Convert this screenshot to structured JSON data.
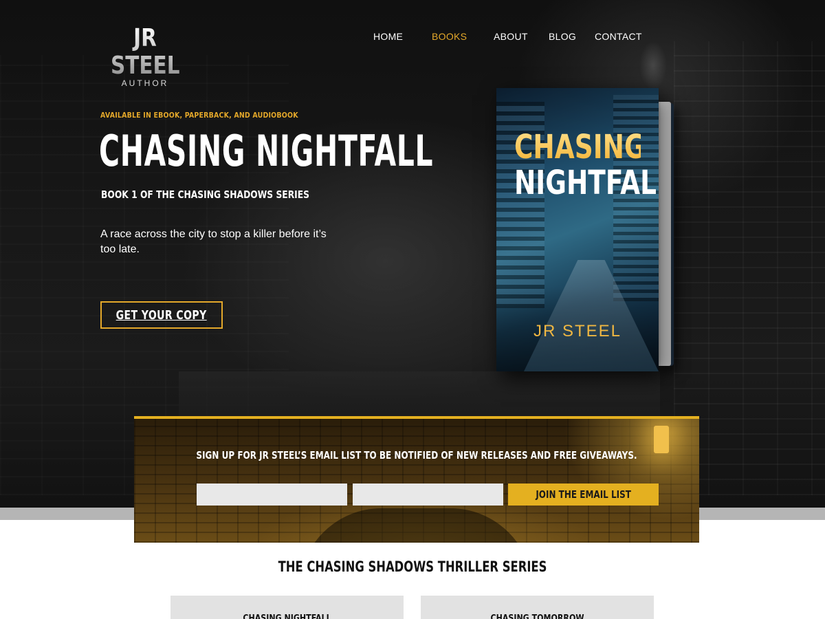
{
  "brand": {
    "name": "JR STEEL",
    "subtitle": "AUTHOR"
  },
  "nav": {
    "items": [
      {
        "label": "HOME",
        "active": false
      },
      {
        "label": "BOOKS",
        "active": true
      },
      {
        "label": "ABOUT",
        "active": false
      },
      {
        "label": "BLOG",
        "active": false
      },
      {
        "label": "CONTACT",
        "active": false
      }
    ]
  },
  "hero": {
    "eyebrow": "AVAILABLE IN EBOOK, PAPERBACK, AND AUDIOBOOK",
    "title": "CHASING NIGHTFALL",
    "series_label": "BOOK 1 OF THE CHASING SHADOWS SERIES",
    "tagline": "A race across the city to stop a killer before it’s too late.",
    "cta_label": "GET YOUR COPY"
  },
  "book_cover": {
    "title_line1": "CHASING",
    "title_line2": "NIGHTFALL",
    "author": "JR STEEL"
  },
  "signup": {
    "text": "SIGN UP FOR JR STEEL’S EMAIL LIST TO BE NOTIFIED OF NEW RELEASES AND FREE GIVEAWAYS.",
    "first_field_value": "",
    "second_field_value": "",
    "button_label": "JOIN THE EMAIL LIST"
  },
  "series_section": {
    "heading": "THE CHASING SHADOWS THRILLER SERIES",
    "cards": [
      {
        "title": "CHASING NIGHTFALL"
      },
      {
        "title": "CHASING TOMORROW"
      }
    ]
  },
  "colors": {
    "accent": "#e4a82a",
    "signup_button": "#e4b020",
    "hero_bg": "#141414",
    "band": "#b5b5b5",
    "card_bg": "#e2e2e2"
  }
}
